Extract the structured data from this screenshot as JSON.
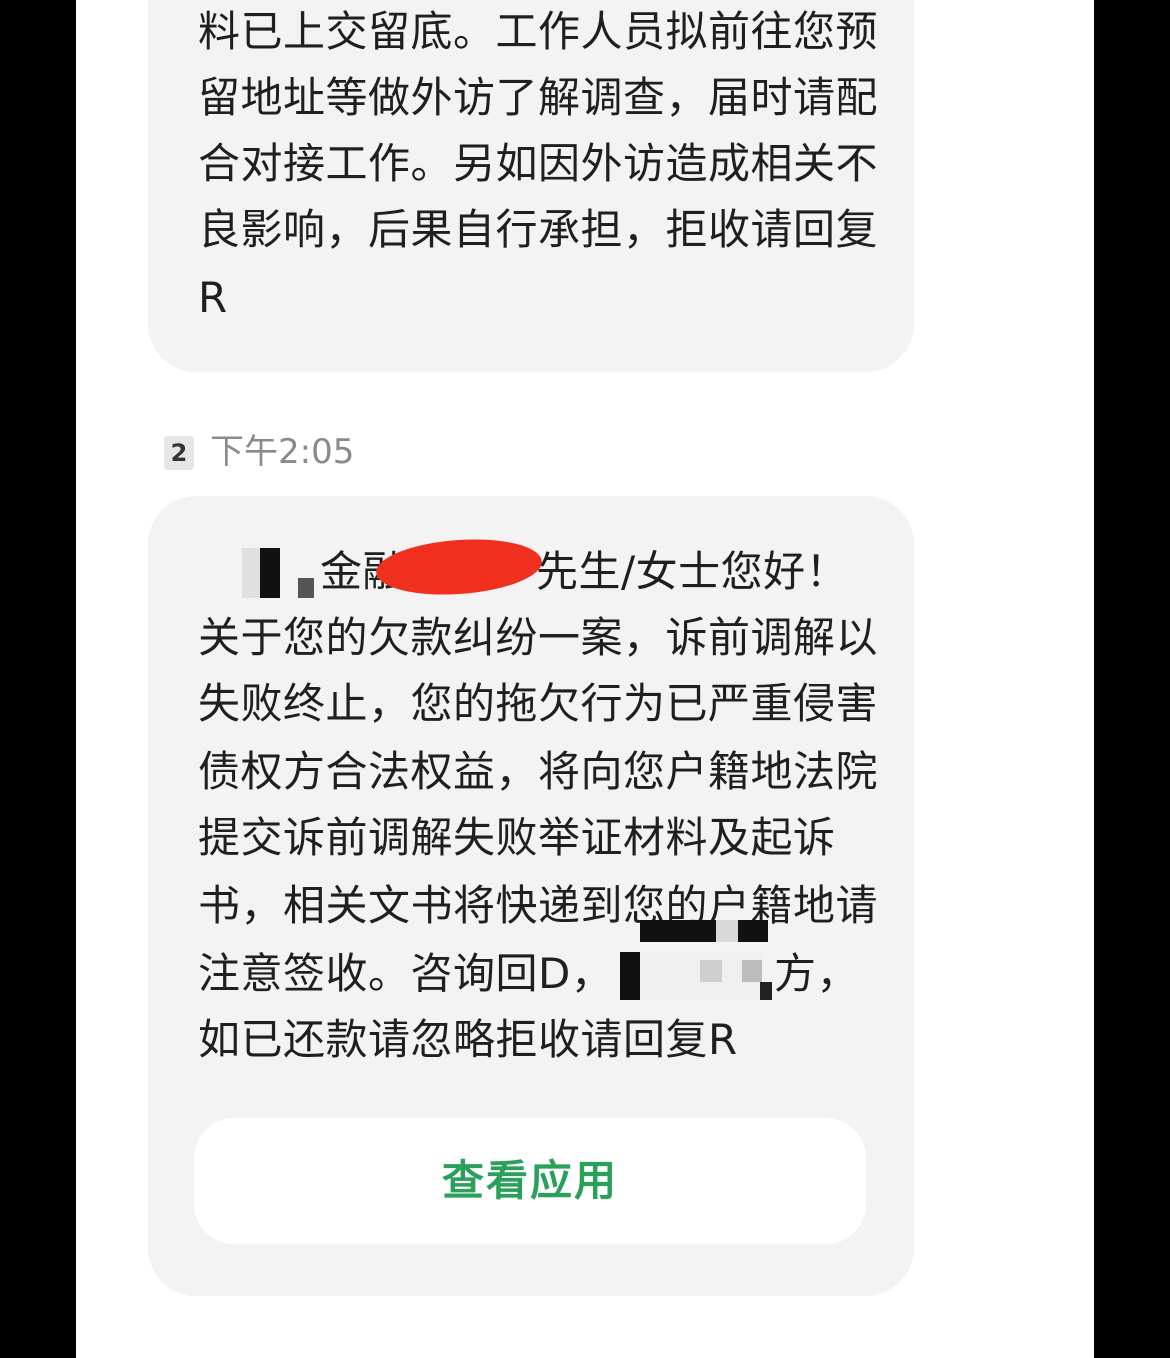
{
  "message_1": {
    "lines": [
      "料已上交留底。工作人员拟前往您预",
      "留地址等做外访了解调查，届时请配",
      "合对接工作。另如因外访造成相关不",
      "良影响，后果自行承担，拒收请回复",
      "R"
    ]
  },
  "message_2": {
    "sim_slot": "2",
    "time": "下午2:05",
    "greeting_fragment_1": "金融",
    "greeting_fragment_2": "先生/女士您好！",
    "lines": [
      "关于您的欠款纠纷一案，诉前调解以",
      "失败终止，您的拖欠行为已严重侵害",
      "债权方合法权益，将向您户籍地法院",
      "提交诉前调解失败举证材料及起诉",
      "书，相关文书将快递到您的户籍地请",
      "注意签收。咨询回D，"
    ],
    "line_7_end": "方，",
    "last_line": "如已还款请忽略拒收请回复R",
    "button_label": "查看应用"
  },
  "colors": {
    "bubble": "#f3f3f3",
    "text": "#1f1f1f",
    "timestamp": "#8a8a8a",
    "button_text": "#2aa05a",
    "redaction_red": "#f0301e"
  }
}
